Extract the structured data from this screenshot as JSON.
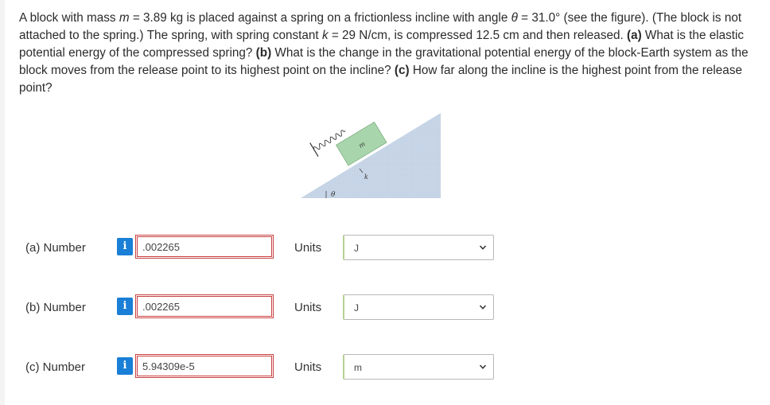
{
  "question": {
    "s1": "A block with mass ",
    "m_var": "m",
    "s2": " = 3.89 kg is placed against a spring on a frictionless incline with angle ",
    "theta_var": "θ",
    "s3": " = 31.0° (see the figure). (The block is not attached to the spring.) The spring, with spring constant ",
    "k_var": "k",
    "s4": " = 29 N/cm, is compressed 12.5 cm and then released. ",
    "a_tag": "(a)",
    "a_text": " What is the elastic potential energy of the compressed spring? ",
    "b_tag": "(b)",
    "b_text": " What is the change in the gravitational potential energy of the block-Earth system as the block moves from the release point to its highest point on the incline? ",
    "c_tag": "(c)",
    "c_text": " How far along the incline is the highest point from the release point?"
  },
  "figure": {
    "block_label": "m",
    "spring_label": "k",
    "angle_label": "θ",
    "colors": {
      "block": "#a8d5ab",
      "incline": "#c5d3e6",
      "spring": "#333333"
    }
  },
  "answers": [
    {
      "label": "(a)  Number",
      "info_icon": "i",
      "value": ".002265",
      "units_label": "Units",
      "unit": "J"
    },
    {
      "label": "(b)  Number",
      "info_icon": "i",
      "value": ".002265",
      "units_label": "Units",
      "unit": "J"
    },
    {
      "label": "(c)  Number",
      "info_icon": "i",
      "value": "5.94309e-5",
      "units_label": "Units",
      "unit": "m"
    }
  ],
  "colors": {
    "info_button": "#1a7fd6",
    "input_border": "#c94040",
    "select_accent": "#b5d095"
  }
}
